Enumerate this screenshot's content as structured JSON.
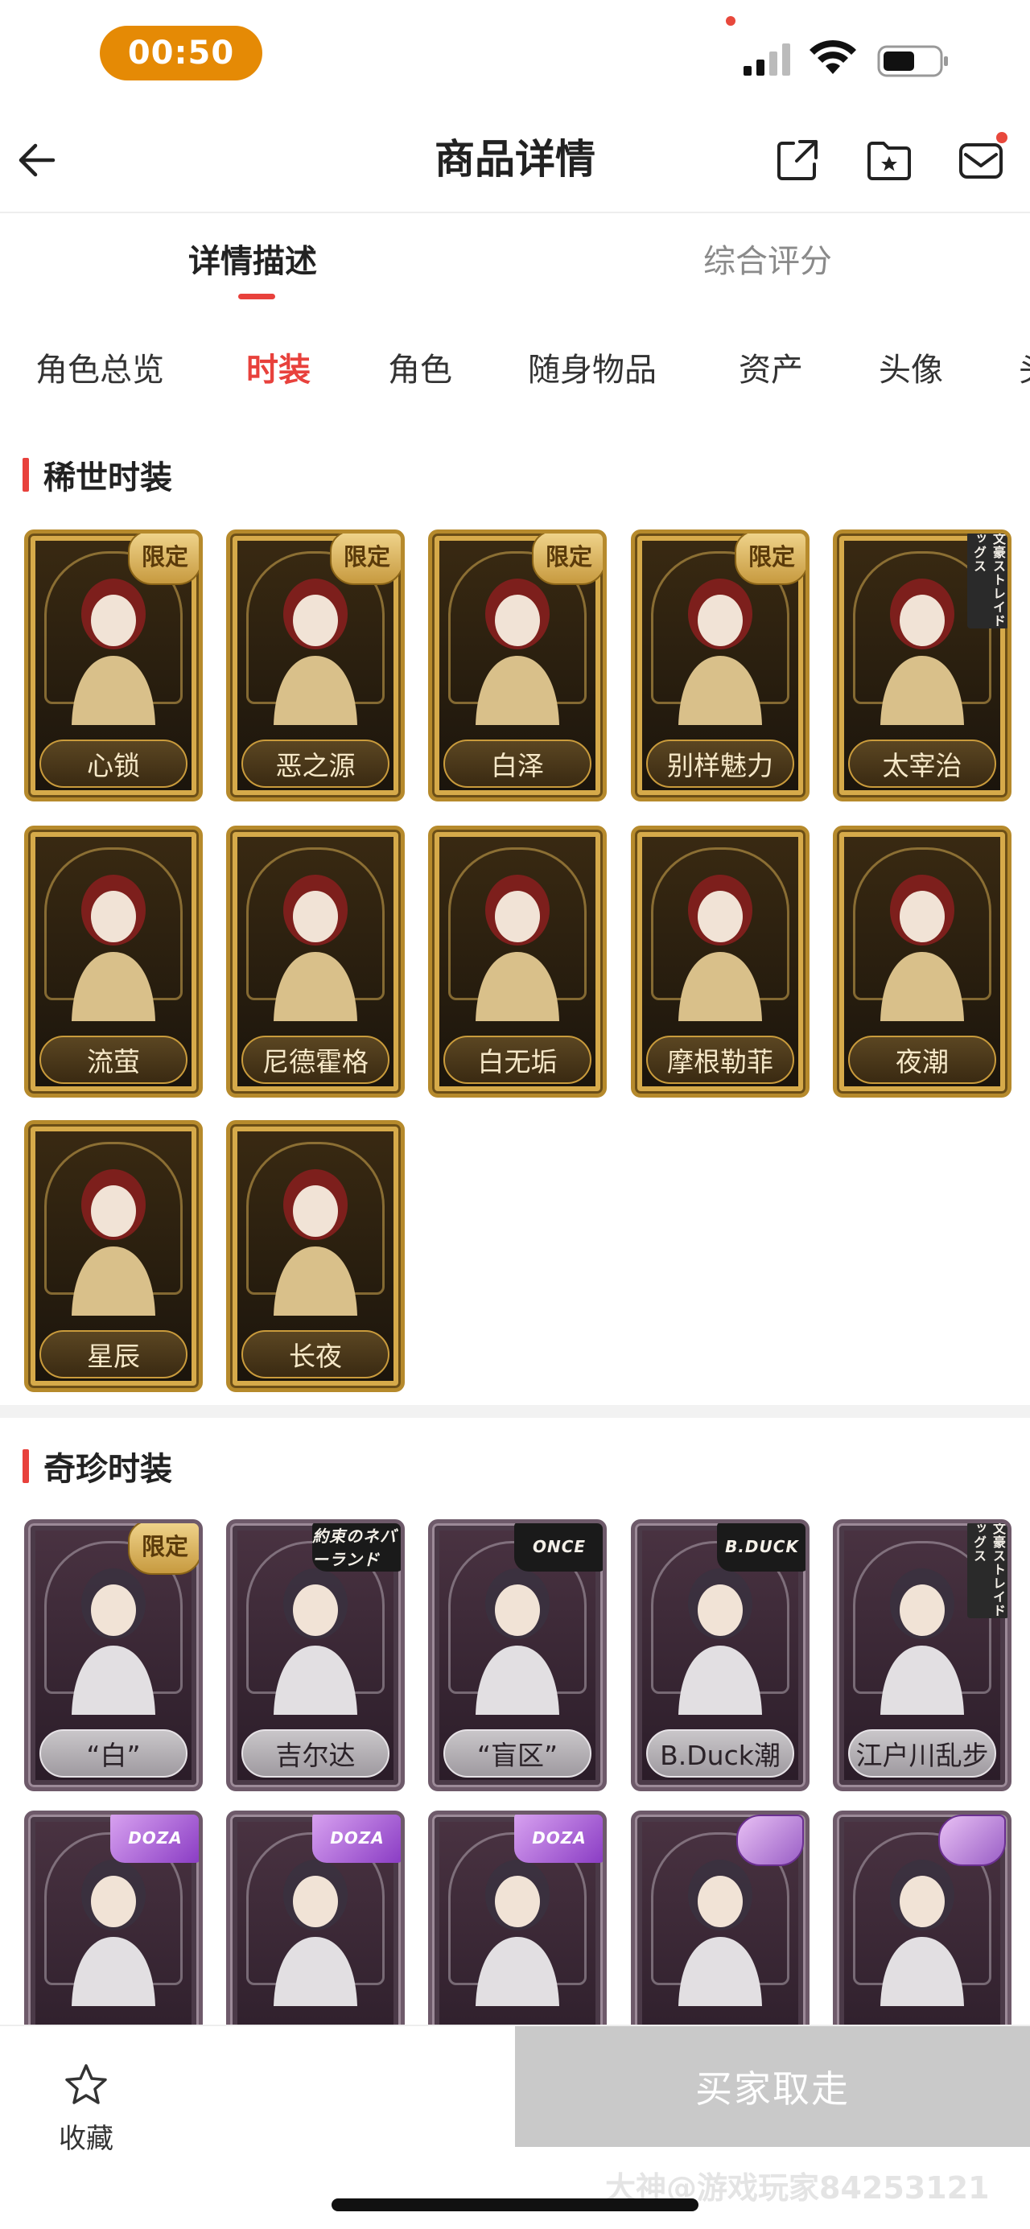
{
  "status_bar": {
    "time": "00:50"
  },
  "nav": {
    "title": "商品详情"
  },
  "main_tabs": [
    {
      "label": "详情描述",
      "active": true
    },
    {
      "label": "综合评分",
      "active": false
    }
  ],
  "sub_tabs": [
    {
      "label": "角色总览",
      "active": false
    },
    {
      "label": "时装",
      "active": true
    },
    {
      "label": "角色",
      "active": false
    },
    {
      "label": "随身物品",
      "active": false
    },
    {
      "label": "资产",
      "active": false
    },
    {
      "label": "头像",
      "active": false
    },
    {
      "label": "头",
      "active": false
    }
  ],
  "sections": [
    {
      "title": "稀世时装",
      "style": "gold",
      "cards": [
        {
          "name": "心锁",
          "badge": "限定"
        },
        {
          "name": "恶之源",
          "badge": "限定"
        },
        {
          "name": "白泽",
          "badge": "限定"
        },
        {
          "name": "别样魅力",
          "badge": "限定"
        },
        {
          "name": "太宰治",
          "badge_type": "collab-vertical",
          "badge": "文豪ストレイドッグス"
        },
        {
          "name": "流萤"
        },
        {
          "name": "尼德霍格"
        },
        {
          "name": "白无垢"
        },
        {
          "name": "摩根勒菲"
        },
        {
          "name": "夜潮"
        },
        {
          "name": "星辰"
        },
        {
          "name": "长夜"
        }
      ]
    },
    {
      "title": "奇珍时装",
      "style": "silver",
      "cards": [
        {
          "name": "“白”",
          "badge": "限定"
        },
        {
          "name": "吉尔达",
          "badge_type": "collab",
          "badge": "約束のネバーランド"
        },
        {
          "name": "“盲区”",
          "badge_type": "collab",
          "badge": "ONCE"
        },
        {
          "name": "B.Duck潮",
          "badge_type": "collab",
          "badge": "B.DUCK"
        },
        {
          "name": "江户川乱步",
          "badge_type": "collab-vertical",
          "badge": "文豪ストレイドッグス"
        },
        {
          "name": "",
          "badge_type": "collab-purple",
          "badge": "DOZA"
        },
        {
          "name": "",
          "badge_type": "collab-purple",
          "badge": "DOZA"
        },
        {
          "name": "",
          "badge_type": "collab-purple",
          "badge": "DOZA"
        },
        {
          "name": "",
          "badge_type": "flower"
        },
        {
          "name": "",
          "badge_type": "flower"
        }
      ]
    }
  ],
  "bottom_bar": {
    "favorite_label": "收藏",
    "buy_label": "买家取走",
    "watermark": "大神@游戏玩家84253121"
  },
  "colors": {
    "accent": "#e8413c",
    "time_pill": "#e58a05",
    "buy_button": "#c9c9c9",
    "rare_gold": "#b68a2c",
    "curio_silver": "#6e5a6a"
  }
}
